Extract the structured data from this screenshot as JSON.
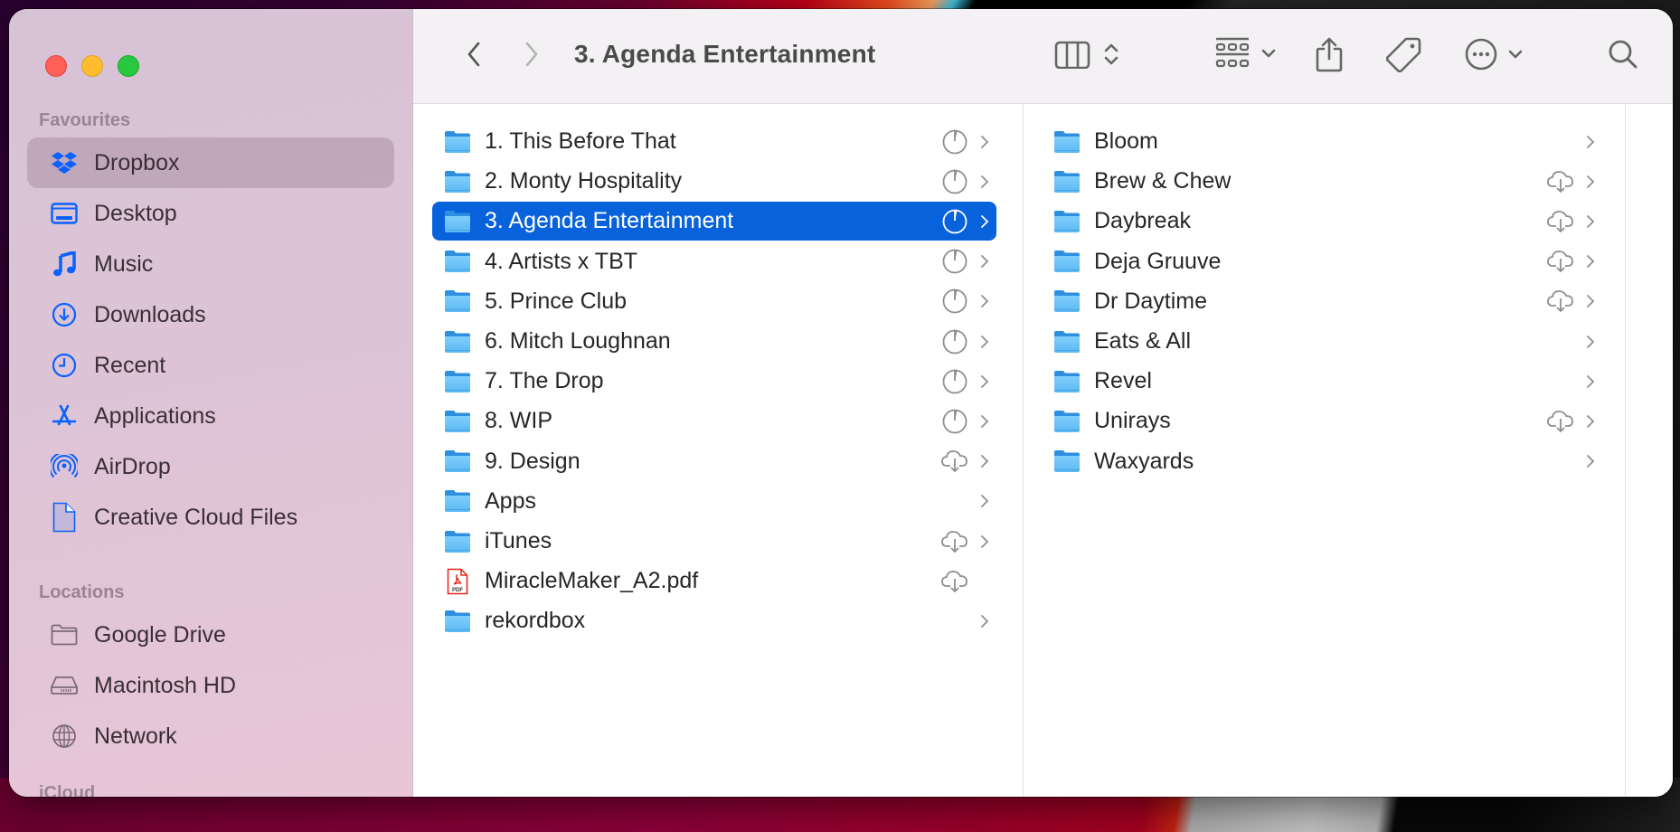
{
  "window": {
    "title": "3. Agenda Entertainment",
    "accent_color": "#0762dc"
  },
  "sidebar": {
    "sections": [
      {
        "title": "Favourites",
        "items": [
          {
            "label": "Dropbox",
            "icon": "dropbox-icon",
            "selected": true
          },
          {
            "label": "Desktop",
            "icon": "desktop-icon"
          },
          {
            "label": "Music",
            "icon": "music-icon"
          },
          {
            "label": "Downloads",
            "icon": "downloads-icon"
          },
          {
            "label": "Recent",
            "icon": "clock-icon"
          },
          {
            "label": "Applications",
            "icon": "applications-icon"
          },
          {
            "label": "AirDrop",
            "icon": "airdrop-icon"
          },
          {
            "label": "Creative Cloud Files",
            "icon": "document-icon"
          }
        ]
      },
      {
        "title": "Locations",
        "items": [
          {
            "label": "Google Drive",
            "icon": "folder-outline-icon"
          },
          {
            "label": "Macintosh HD",
            "icon": "hard-drive-icon"
          },
          {
            "label": "Network",
            "icon": "globe-icon"
          }
        ]
      },
      {
        "title": "iCloud",
        "items": []
      }
    ]
  },
  "toolbar": {
    "back": "back-chevron-icon",
    "forward": "forward-chevron-icon",
    "view_mode": "column-view-icon",
    "group": "group-grid-icon",
    "share": "share-icon",
    "tags": "tag-icon",
    "more": "ellipsis-circle-icon",
    "search": "search-icon"
  },
  "columns": [
    {
      "items": [
        {
          "name": "1. This Before That",
          "type": "folder",
          "status": "syncing",
          "has_children": true
        },
        {
          "name": "2. Monty Hospitality",
          "type": "folder",
          "status": "syncing",
          "has_children": true
        },
        {
          "name": "3. Agenda Entertainment",
          "type": "folder",
          "status": "syncing",
          "has_children": true,
          "selected": true
        },
        {
          "name": "4. Artists x TBT",
          "type": "folder",
          "status": "syncing",
          "has_children": true
        },
        {
          "name": "5. Prince Club",
          "type": "folder",
          "status": "syncing",
          "has_children": true
        },
        {
          "name": "6. Mitch Loughnan",
          "type": "folder",
          "status": "syncing",
          "has_children": true
        },
        {
          "name": "7. The Drop",
          "type": "folder",
          "status": "syncing",
          "has_children": true
        },
        {
          "name": "8. WIP",
          "type": "folder",
          "status": "syncing",
          "has_children": true
        },
        {
          "name": "9. Design",
          "type": "folder",
          "status": "cloud",
          "has_children": true
        },
        {
          "name": "Apps",
          "type": "folder",
          "status": "",
          "has_children": true
        },
        {
          "name": "iTunes",
          "type": "folder",
          "status": "cloud",
          "has_children": true
        },
        {
          "name": "MiracleMaker_A2.pdf",
          "type": "pdf",
          "status": "cloud",
          "has_children": false
        },
        {
          "name": "rekordbox",
          "type": "folder",
          "status": "",
          "has_children": true
        }
      ]
    },
    {
      "items": [
        {
          "name": "Bloom",
          "type": "folder",
          "status": "",
          "has_children": true
        },
        {
          "name": "Brew & Chew",
          "type": "folder",
          "status": "cloud",
          "has_children": true
        },
        {
          "name": "Daybreak",
          "type": "folder",
          "status": "cloud",
          "has_children": true
        },
        {
          "name": "Deja Gruuve",
          "type": "folder",
          "status": "cloud",
          "has_children": true
        },
        {
          "name": "Dr Daytime",
          "type": "folder",
          "status": "cloud",
          "has_children": true
        },
        {
          "name": "Eats & All",
          "type": "folder",
          "status": "",
          "has_children": true
        },
        {
          "name": "Revel",
          "type": "folder",
          "status": "",
          "has_children": true
        },
        {
          "name": "Unirays",
          "type": "folder",
          "status": "cloud",
          "has_children": true
        },
        {
          "name": "Waxyards",
          "type": "folder",
          "status": "",
          "has_children": true
        }
      ]
    }
  ]
}
